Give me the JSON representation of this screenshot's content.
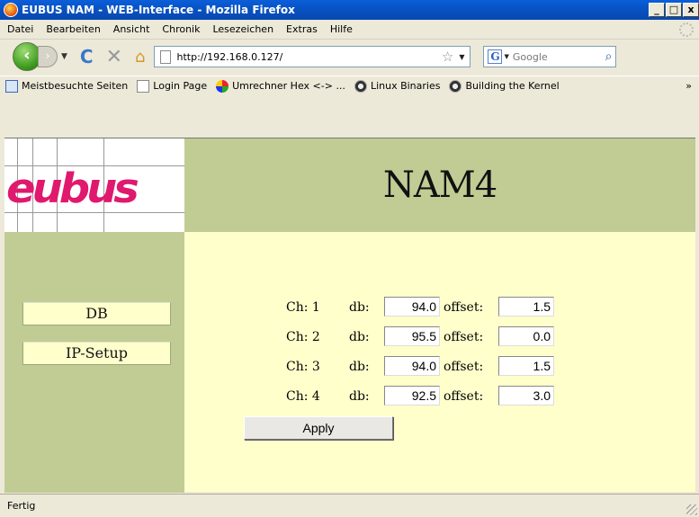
{
  "window": {
    "title": "EUBUS NAM - WEB-Interface - Mozilla Firefox",
    "controls": [
      "_",
      "□",
      "x"
    ]
  },
  "menubar": {
    "items": [
      "Datei",
      "Bearbeiten",
      "Ansicht",
      "Chronik",
      "Lesezeichen",
      "Extras",
      "Hilfe"
    ]
  },
  "navbar": {
    "back_glyph": "‹",
    "forward_glyph": "›",
    "url": "http://192.168.0.127/",
    "search_placeholder": "Google",
    "search_engine_glyph": "G"
  },
  "bookmarks": {
    "items": [
      {
        "label": "Meistbesuchte Seiten",
        "icon": "most-visited-icon"
      },
      {
        "label": "Login Page",
        "icon": "page-icon"
      },
      {
        "label": "Umrechner Hex <-> ...",
        "icon": "converter-icon"
      },
      {
        "label": "Linux Binaries",
        "icon": "tux-icon"
      },
      {
        "label": "Building the Kernel",
        "icon": "tux-icon"
      }
    ],
    "more": "»"
  },
  "page": {
    "logo_text": "eubus",
    "title": "NAM4",
    "nav": [
      {
        "label": "DB"
      },
      {
        "label": "IP-Setup"
      }
    ],
    "db_label": "db:",
    "offset_label": "offset:",
    "channels": [
      {
        "label": "Ch: 1",
        "db": "94.0",
        "offset": "1.5"
      },
      {
        "label": "Ch: 2",
        "db": "95.5",
        "offset": "0.0"
      },
      {
        "label": "Ch: 3",
        "db": "94.0",
        "offset": "1.5"
      },
      {
        "label": "Ch: 4",
        "db": "92.5",
        "offset": "3.0"
      }
    ],
    "apply_label": "Apply",
    "colors": {
      "band": "#C0CC94",
      "content_bg": "#FFFFCC",
      "logo_accent": "#E0186E"
    }
  },
  "status": {
    "text": "Fertig"
  }
}
